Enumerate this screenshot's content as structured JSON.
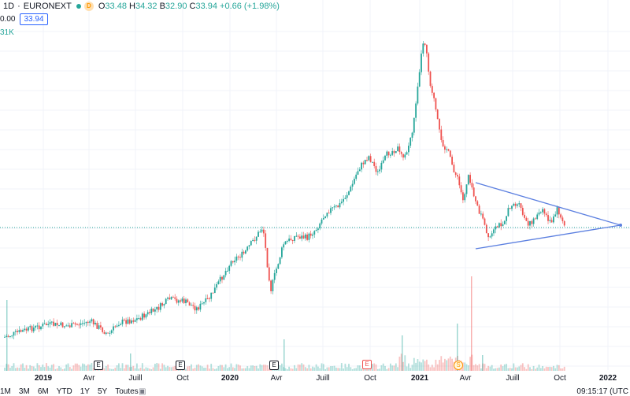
{
  "legend": {
    "timeframe": "1D",
    "separator": "·",
    "exchange": "EURONEXT",
    "badge": "D",
    "o_label": "O",
    "o": "33.48",
    "h_label": "H",
    "h": "34.32",
    "b_label": "B",
    "b": "32.90",
    "c_label": "C",
    "c": "33.94",
    "change": "+0.66 (+1.98%)"
  },
  "subline": {
    "lead": "0.00",
    "price_box": "33.94"
  },
  "volume_label": "31K",
  "events": {
    "earnings": "E",
    "dividend": "S"
  },
  "x_axis": {
    "labels": [
      "2019",
      "Avr",
      "Juill",
      "Oct",
      "2020",
      "Avr",
      "Juill",
      "Oct",
      "2021",
      "Avr",
      "Juill",
      "Oct",
      "2022"
    ]
  },
  "bottom": {
    "ranges": [
      "1M",
      "3M",
      "6M",
      "YTD",
      "1Y",
      "5Y",
      "Toutes"
    ],
    "time": "09:15:17 (UTC"
  },
  "colors": {
    "up": "#26a69a",
    "down": "#ef5350",
    "trendline": "#5b7fe0",
    "price_line": "#26a69a"
  }
}
